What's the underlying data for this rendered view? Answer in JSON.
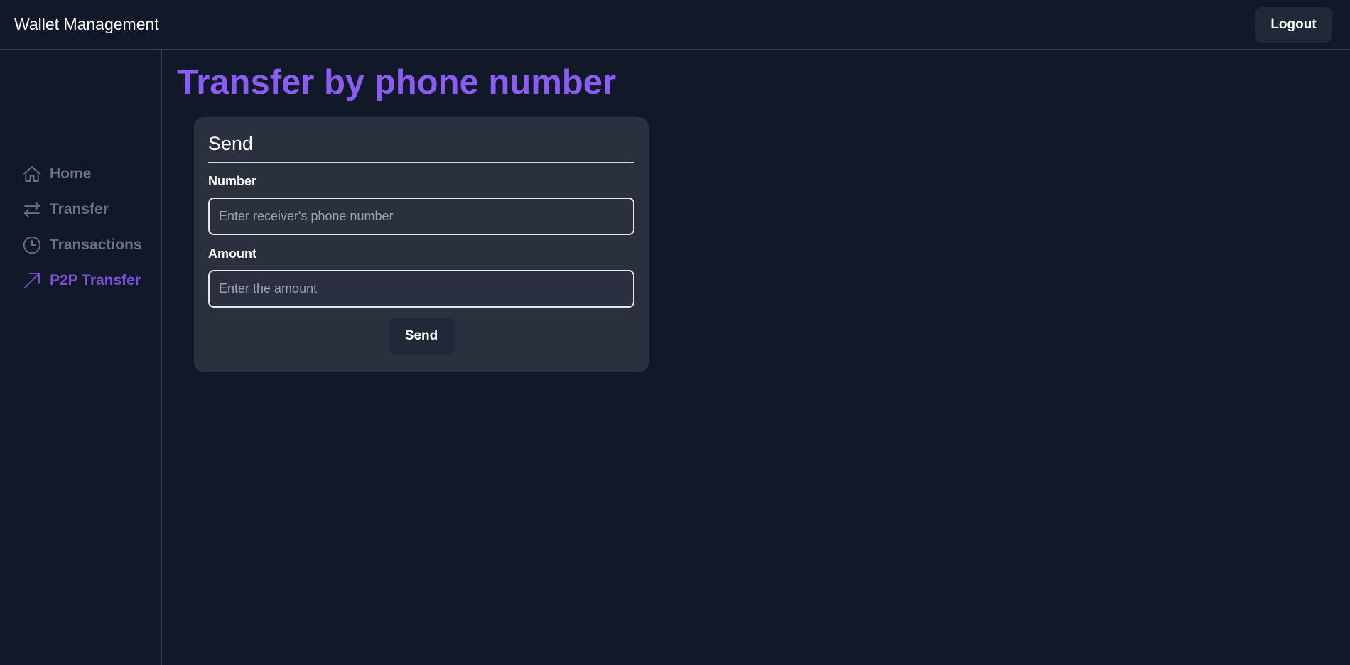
{
  "header": {
    "app_title": "Wallet Management",
    "logout_label": "Logout"
  },
  "sidebar": {
    "items": [
      {
        "label": "Home",
        "icon": "home-icon",
        "active": false
      },
      {
        "label": "Transfer",
        "icon": "arrows-exchange-icon",
        "active": false
      },
      {
        "label": "Transactions",
        "icon": "clock-icon",
        "active": false
      },
      {
        "label": "P2P Transfer",
        "icon": "arrow-up-right-icon",
        "active": true
      }
    ],
    "inactive_color": "#6b7280",
    "active_color": "#7c4fd6"
  },
  "main": {
    "page_title": "Transfer by phone number",
    "card": {
      "title": "Send",
      "number_label": "Number",
      "number_value": "",
      "number_placeholder": "Enter receiver's phone number",
      "amount_label": "Amount",
      "amount_value": "",
      "amount_placeholder": "Enter the amount",
      "send_label": "Send"
    }
  },
  "colors": {
    "background": "#111827",
    "accent": "#8b5cf6",
    "card": "#2a303d",
    "button": "#1f2937"
  }
}
